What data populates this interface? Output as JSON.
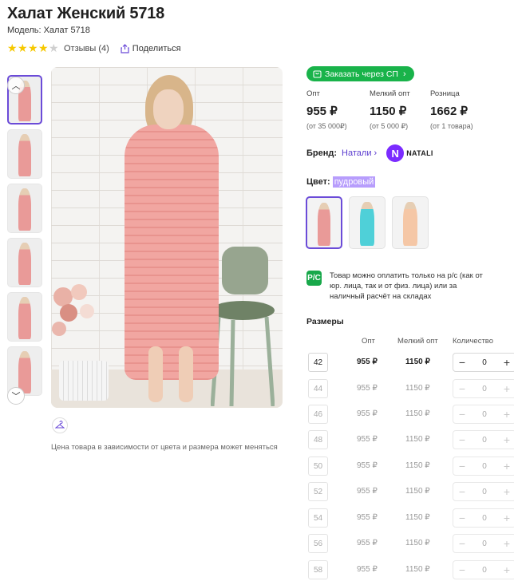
{
  "product": {
    "title": "Халат Женский 5718",
    "model": "Модель: Халат 5718",
    "rating_value": 4,
    "rating_max": 5,
    "reviews": "Отзывы (4)",
    "share": "Поделиться"
  },
  "gallery": {
    "note": "Цена товара в зависимости от цвета и размера может меняться"
  },
  "order_button": "Заказать через СП",
  "prices": [
    {
      "label": "Опт",
      "value": "955 ₽",
      "sub": "(от 35 000₽)"
    },
    {
      "label": "Мелкий опт",
      "value": "1150 ₽",
      "sub": "(от 5 000 ₽)"
    },
    {
      "label": "Розница",
      "value": "1662 ₽",
      "sub": "(от 1 товара)"
    }
  ],
  "brand": {
    "label": "Бренд:",
    "link": "Натали",
    "logo_letter": "N",
    "logo_text": "NATALI"
  },
  "color": {
    "label": "Цвет:",
    "value": "пудровый"
  },
  "swatch_colors": [
    "#e99a98",
    "#4fd0d8",
    "#f5c7a6"
  ],
  "payment": {
    "icon": "P/C",
    "text": "Товар можно оплатить только на р/с (как от юр. лица, так и от физ. лица) или за наличный расчёт на складах"
  },
  "sizes": {
    "title": "Размеры",
    "headers": {
      "opt": "Опт",
      "small_opt": "Мелкий опт",
      "qty": "Количество"
    },
    "rows": [
      {
        "size": "42",
        "opt": "955 ₽",
        "small_opt": "1150 ₽",
        "qty": "0"
      },
      {
        "size": "44",
        "opt": "955 ₽",
        "small_opt": "1150 ₽",
        "qty": "0"
      },
      {
        "size": "46",
        "opt": "955 ₽",
        "small_opt": "1150 ₽",
        "qty": "0"
      },
      {
        "size": "48",
        "opt": "955 ₽",
        "small_opt": "1150 ₽",
        "qty": "0"
      },
      {
        "size": "50",
        "opt": "955 ₽",
        "small_opt": "1150 ₽",
        "qty": "0"
      },
      {
        "size": "52",
        "opt": "955 ₽",
        "small_opt": "1150 ₽",
        "qty": "0"
      },
      {
        "size": "54",
        "opt": "955 ₽",
        "small_opt": "1150 ₽",
        "qty": "0"
      },
      {
        "size": "56",
        "opt": "955 ₽",
        "small_opt": "1150 ₽",
        "qty": "0"
      },
      {
        "size": "58",
        "opt": "955 ₽",
        "small_opt": "1150 ₽",
        "qty": "0"
      }
    ]
  }
}
